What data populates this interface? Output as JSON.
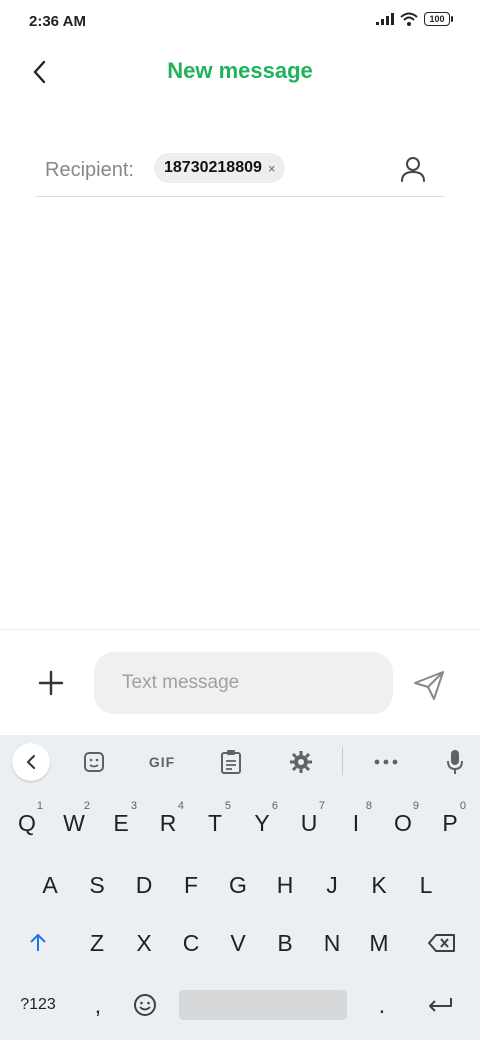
{
  "status_bar": {
    "time": "2:36 AM",
    "battery": "100",
    "icons": [
      "signal-icon",
      "wifi-icon",
      "battery-icon"
    ]
  },
  "header": {
    "title": "New message",
    "back_icon": "back-arrow-icon",
    "title_color": "#21b35c"
  },
  "recipient": {
    "label": "Recipient:",
    "chip": "18730218809",
    "chip_remove": "×",
    "contact_icon": "person-icon"
  },
  "compose": {
    "placeholder": "Text message",
    "value": "",
    "add_icon": "plus-icon",
    "send_icon": "send-icon"
  },
  "keyboard": {
    "toolbar": {
      "gif_label": "GIF",
      "icons": [
        "chevron-left-icon",
        "sticker-icon",
        "gif-icon",
        "clipboard-icon",
        "gear-icon",
        "more-icon",
        "mic-icon"
      ]
    },
    "row1": [
      {
        "k": "Q",
        "h": "1"
      },
      {
        "k": "W",
        "h": "2"
      },
      {
        "k": "E",
        "h": "3"
      },
      {
        "k": "R",
        "h": "4"
      },
      {
        "k": "T",
        "h": "5"
      },
      {
        "k": "Y",
        "h": "6"
      },
      {
        "k": "U",
        "h": "7"
      },
      {
        "k": "I",
        "h": "8"
      },
      {
        "k": "O",
        "h": "9"
      },
      {
        "k": "P",
        "h": "0"
      }
    ],
    "row2": [
      "A",
      "S",
      "D",
      "F",
      "G",
      "H",
      "J",
      "K",
      "L"
    ],
    "row3": [
      "Z",
      "X",
      "C",
      "V",
      "B",
      "N",
      "M"
    ],
    "bottom": {
      "symbols": "?123",
      "comma": ",",
      "period": "."
    },
    "accent_color": "#1a73e8"
  }
}
